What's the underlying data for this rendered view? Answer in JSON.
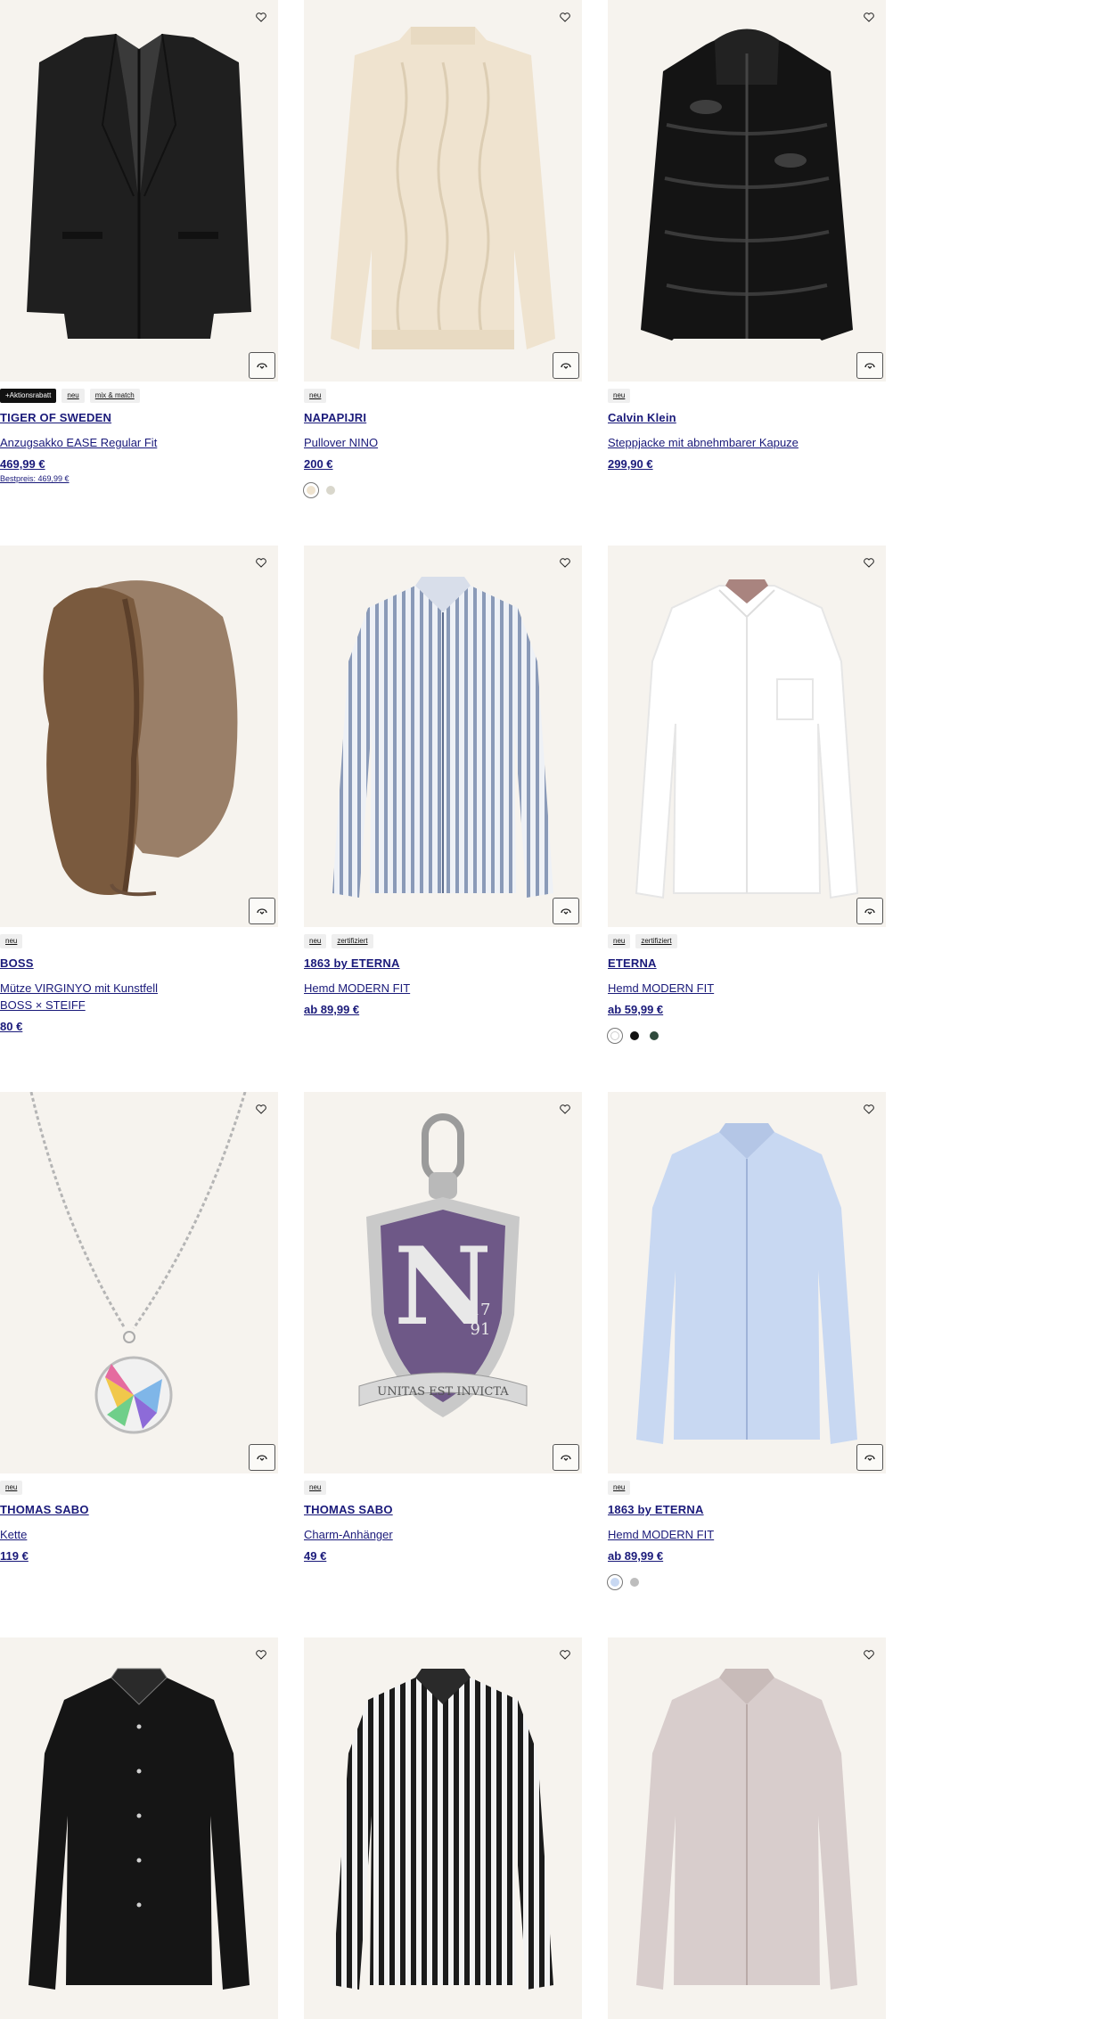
{
  "products": [
    {
      "brand": "TIGER OF SWEDEN",
      "name": "Anzugsakko EASE Regular Fit",
      "price": "469,99 €",
      "best": "Bestpreis: 469,99 €",
      "badges": [
        {
          "text": "+Aktionsrabatt",
          "dark": true
        },
        {
          "text": "neu"
        },
        {
          "text": "mix & match"
        }
      ],
      "swatches": []
    },
    {
      "brand": "NAPAPIJRI",
      "name": "Pullover NINO",
      "price": "200 €",
      "badges": [
        {
          "text": "neu"
        }
      ],
      "swatches": [
        "#efe3cf",
        "#d9d7cc"
      ]
    },
    {
      "brand": "Calvin Klein",
      "name": "Steppjacke mit abnehmbarer Kapuze",
      "price": "299,90 €",
      "badges": [
        {
          "text": "neu"
        }
      ],
      "swatches": []
    },
    {
      "brand": "BOSS",
      "name": "Mütze VIRGINYO mit Kunstfell",
      "name2": "BOSS × STEIFF",
      "price": "80 €",
      "badges": [
        {
          "text": "neu"
        }
      ],
      "swatches": []
    },
    {
      "brand": "1863 by ETERNA",
      "name": "Hemd MODERN FIT",
      "price": "ab 89,99 €",
      "badges": [
        {
          "text": "neu"
        },
        {
          "text": "zertifiziert"
        }
      ],
      "swatches": []
    },
    {
      "brand": "ETERNA",
      "name": "Hemd MODERN FIT",
      "price": "ab 59,99 €",
      "badges": [
        {
          "text": "neu"
        },
        {
          "text": "zertifiziert"
        }
      ],
      "swatches": [
        "#ffffff",
        "#111111",
        "#2f4a3c"
      ]
    },
    {
      "brand": "THOMAS SABO",
      "name": "Kette",
      "price": "119 €",
      "badges": [
        {
          "text": "neu"
        }
      ],
      "swatches": []
    },
    {
      "brand": "THOMAS SABO",
      "name": "Charm-Anhänger",
      "price": "49 €",
      "badges": [
        {
          "text": "neu"
        }
      ],
      "swatches": []
    },
    {
      "brand": "1863 by ETERNA",
      "name": "Hemd MODERN FIT",
      "price": "ab 89,99 €",
      "badges": [
        {
          "text": "neu"
        }
      ],
      "swatches": [
        "#c8d8f2",
        "#bdbdbd"
      ]
    },
    {
      "swatches": []
    },
    {
      "swatches": []
    },
    {
      "swatches": []
    }
  ],
  "charm_text": {
    "letter": "N",
    "year_top": "17",
    "year_bottom": "91",
    "motto": "UNITAS EST INVICTA"
  },
  "icons": {
    "wishlist": "heart-icon",
    "virtual_try_on": "try-on-icon"
  }
}
